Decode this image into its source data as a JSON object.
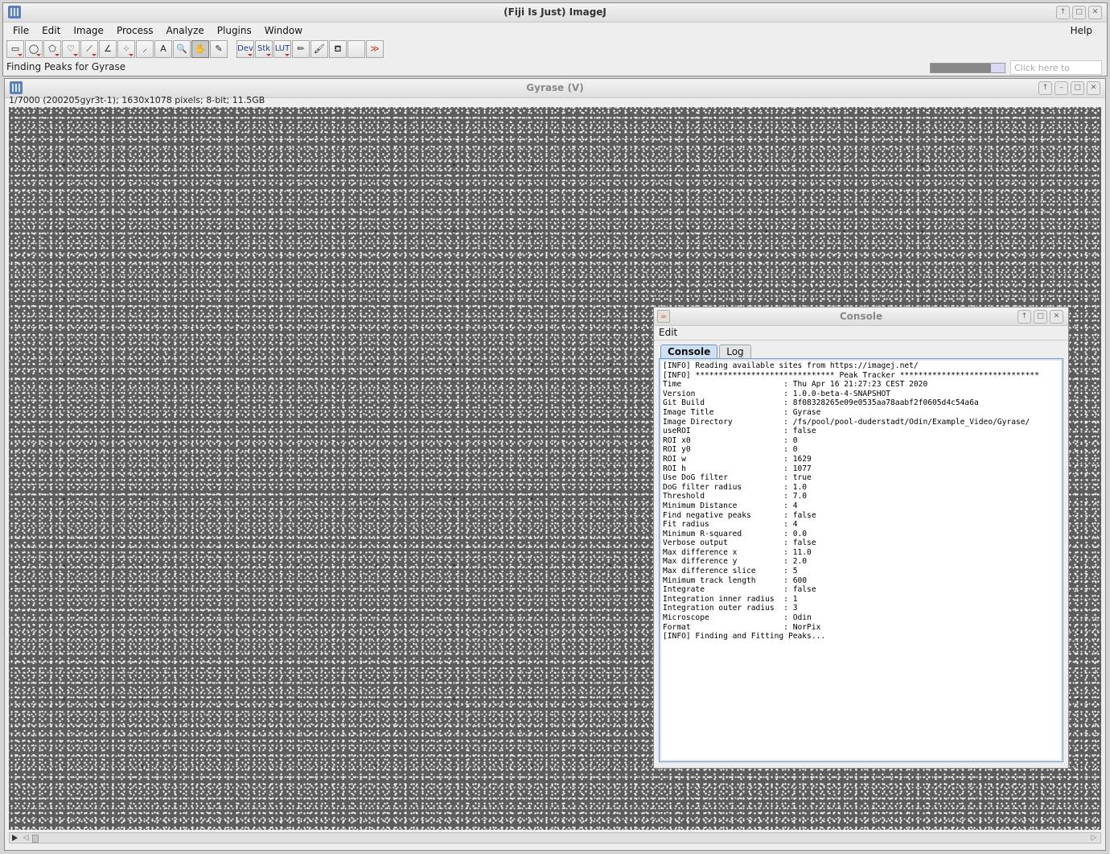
{
  "main_window": {
    "title": "(Fiji Is Just) ImageJ",
    "menus": [
      "File",
      "Edit",
      "Image",
      "Process",
      "Analyze",
      "Plugins",
      "Window"
    ],
    "help": "Help",
    "status": "Finding Peaks for Gyrase",
    "progress": 0.82,
    "search_placeholder": "Click here to search",
    "tools": [
      {
        "name": "rectangle-tool-icon",
        "glyph": "▭"
      },
      {
        "name": "oval-tool-icon",
        "glyph": "◯"
      },
      {
        "name": "polygon-tool-icon",
        "glyph": "⬠"
      },
      {
        "name": "freehand-tool-icon",
        "glyph": "♡"
      },
      {
        "name": "line-tool-icon",
        "glyph": "⟋"
      },
      {
        "name": "angle-tool-icon",
        "glyph": "∠"
      },
      {
        "name": "multipoint-tool-icon",
        "glyph": "⁘"
      },
      {
        "name": "wand-tool-icon",
        "glyph": "⸝"
      },
      {
        "name": "text-tool-icon",
        "glyph": "A"
      },
      {
        "name": "magnifier-tool-icon",
        "glyph": "🔍"
      },
      {
        "name": "hand-tool-icon",
        "glyph": "✋"
      },
      {
        "name": "color-picker-tool-icon",
        "glyph": "✎"
      },
      {
        "name": "dev-tool-icon",
        "glyph": "Dev"
      },
      {
        "name": "stk-tool-icon",
        "glyph": "Stk"
      },
      {
        "name": "lut-tool-icon",
        "glyph": "LUT"
      },
      {
        "name": "pencil-tool-icon",
        "glyph": "✏"
      },
      {
        "name": "brush-tool-icon",
        "glyph": "🖌"
      },
      {
        "name": "flood-fill-tool-icon",
        "glyph": "⛾"
      },
      {
        "name": "empty-tool-slot",
        "glyph": ""
      },
      {
        "name": "more-tools-icon",
        "glyph": "≫"
      }
    ]
  },
  "image_window": {
    "title": "Gyrase (V)",
    "subtitle": "1/7000 (200205gyr3t-1); 1630x1078 pixels; 8-bit; 11.5GB"
  },
  "console_window": {
    "title": "Console",
    "menu": "Edit",
    "tabs": [
      "Console",
      "Log"
    ],
    "lines": [
      "[INFO] Reading available sites from https://imagej.net/",
      "[INFO] ****************************** Peak Tracker ******************************",
      "Time                      : Thu Apr 16 21:27:23 CEST 2020",
      "Version                   : 1.0.0-beta-4-SNAPSHOT",
      "Git Build                 : 8f08328265e09e0535aa78aabf2f0605d4c54a6a",
      "Image Title               : Gyrase",
      "Image Directory           : /fs/pool/pool-duderstadt/Odin/Example_Video/Gyrase/",
      "useROI                    : false",
      "ROI x0                    : 0",
      "ROI y0                    : 0",
      "ROI w                     : 1629",
      "ROI h                     : 1077",
      "Use DoG filter            : true",
      "DoG filter radius         : 1.0",
      "Threshold                 : 7.0",
      "Minimum Distance          : 4",
      "Find negative peaks       : false",
      "Fit radius                : 4",
      "Minimum R-squared         : 0.0",
      "Verbose output            : false",
      "Max difference x          : 11.0",
      "Max difference y          : 2.0",
      "Max difference slice      : 5",
      "Minimum track length      : 600",
      "Integrate                 : false",
      "Integration inner radius  : 1",
      "Integration outer radius  : 3",
      "Microscope                : Odin",
      "Format                    : NorPix",
      "[INFO] Finding and Fitting Peaks..."
    ]
  }
}
